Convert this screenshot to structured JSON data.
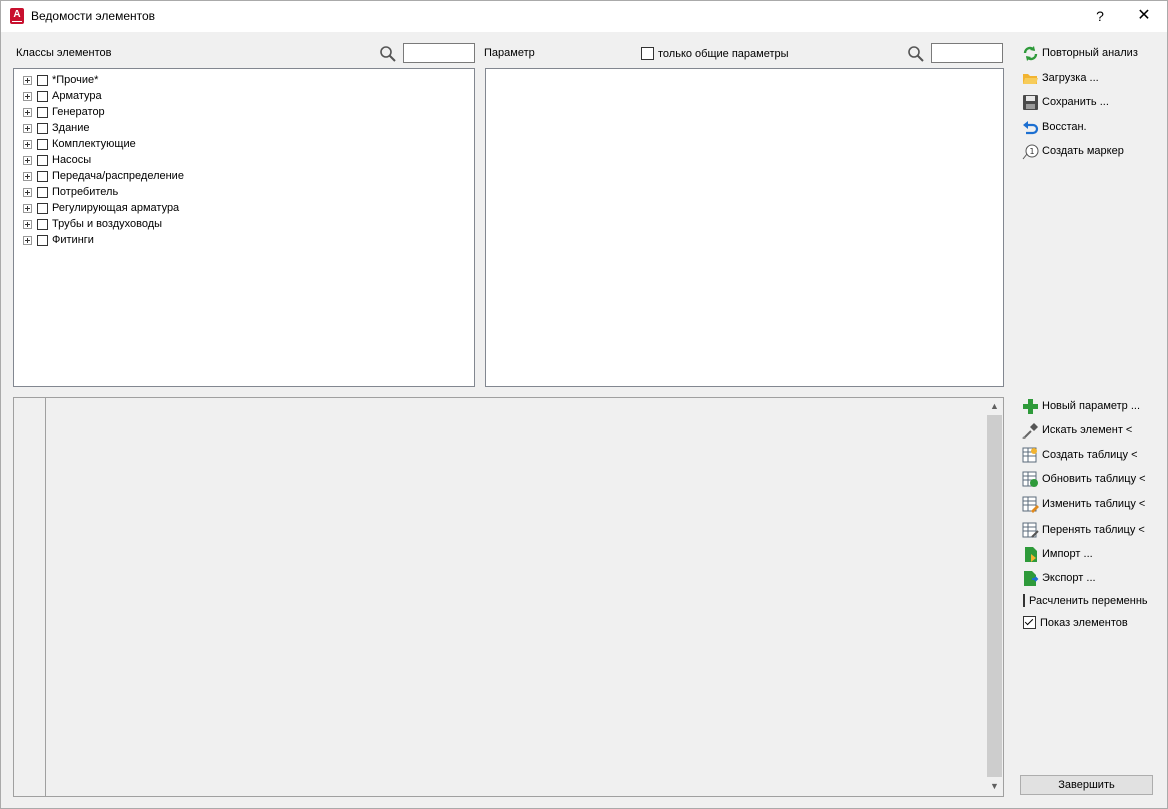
{
  "window": {
    "title": "Ведомости элементов",
    "help": "?",
    "close": "✕",
    "app_icon_letter": "A"
  },
  "classes": {
    "label": "Классы элементов",
    "search_value": "",
    "items": [
      {
        "label": "*Прочие*"
      },
      {
        "label": "Арматура"
      },
      {
        "label": "Генератор"
      },
      {
        "label": "Здание"
      },
      {
        "label": "Комплектующие"
      },
      {
        "label": "Насосы"
      },
      {
        "label": "Передача/распределение"
      },
      {
        "label": "Потребитель"
      },
      {
        "label": "Регулирующая арматура"
      },
      {
        "label": "Трубы и воздуховоды"
      },
      {
        "label": "Фитинги"
      }
    ]
  },
  "params": {
    "label": "Параметр",
    "only_common_label": "только общие параметры",
    "search_value": ""
  },
  "actions_top": [
    {
      "label": "Повторный анализ",
      "icon": "refresh-icon"
    },
    {
      "label": "Загрузка ...",
      "icon": "open-folder-icon"
    },
    {
      "label": "Сохранить ...",
      "icon": "save-icon"
    },
    {
      "label": "Восстан.",
      "icon": "undo-icon"
    },
    {
      "label": "Создать маркер",
      "icon": "marker-icon"
    }
  ],
  "actions_bottom": [
    {
      "label": "Новый параметр ...",
      "icon": "plus-icon"
    },
    {
      "label": "Искать элемент <",
      "icon": "pick-icon"
    },
    {
      "label": "Создать таблицу <",
      "icon": "table-create-icon"
    },
    {
      "label": "Обновить таблицу <",
      "icon": "table-refresh-icon"
    },
    {
      "label": "Изменить таблицу <",
      "icon": "table-edit-icon"
    },
    {
      "label": "Перенять таблицу <",
      "icon": "table-adopt-icon"
    },
    {
      "label": "Импорт ...",
      "icon": "import-icon"
    },
    {
      "label": "Экспорт ...",
      "icon": "export-icon"
    }
  ],
  "options": {
    "explode_label": "Расчленить переменные",
    "explode_checked": false,
    "show_elements_label": "Показ элементов",
    "show_elements_checked": true
  },
  "finish_label": "Завершить",
  "colors": {
    "accent_red": "#c8102e",
    "green": "#2e9a3a",
    "blue": "#1c6fd1",
    "folder": "#f2b431"
  }
}
